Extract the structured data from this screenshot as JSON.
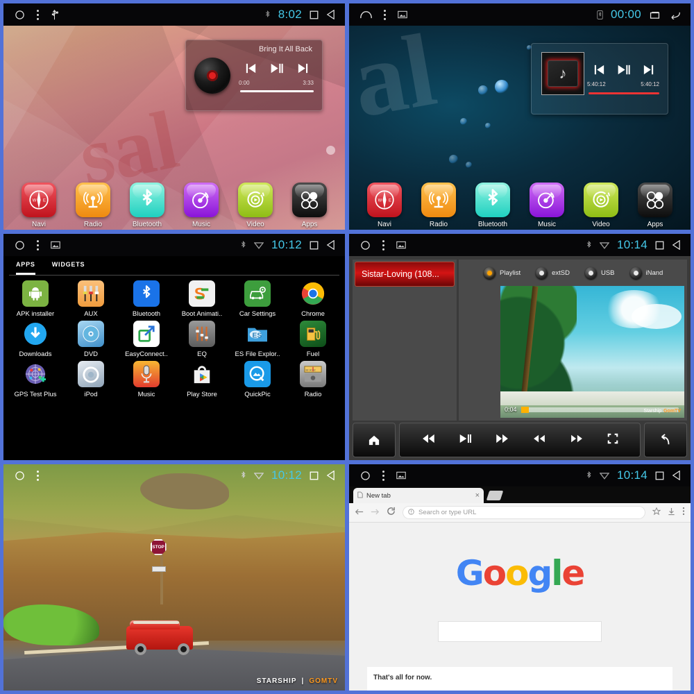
{
  "meta": {
    "frame_color": "#5272d8",
    "accent_cyan": "#45c8e8"
  },
  "panels": {
    "home_red": {
      "status": {
        "clock": "8:02",
        "left_icons": [
          "home-circle-icon",
          "menu-dots-icon",
          "usb-icon"
        ],
        "right_icons": [
          "bluetooth-icon",
          "recents-square-icon",
          "back-triangle-icon"
        ]
      },
      "widget": {
        "title": "Bring It All Back",
        "elapsed": "0:00",
        "duration": "3:33",
        "controls": [
          "previous-track",
          "play-pause",
          "next-track"
        ]
      },
      "watermark": "sal",
      "dock": [
        {
          "label": "Navi",
          "icon": "compass-icon"
        },
        {
          "label": "Radio",
          "icon": "radio-tower-icon"
        },
        {
          "label": "Bluetooth",
          "icon": "bluetooth-icon"
        },
        {
          "label": "Music",
          "icon": "music-disc-icon"
        },
        {
          "label": "Video",
          "icon": "video-play-icon"
        },
        {
          "label": "Apps",
          "icon": "apps-grid-icon"
        }
      ]
    },
    "home_blue": {
      "status": {
        "clock": "00:00",
        "left_icons": [
          "home-outline-icon",
          "menu-dots-icon",
          "screenshot-icon"
        ],
        "right_icons": [
          "bluetooth-icon",
          "recents-square-icon",
          "back-arrow-icon"
        ]
      },
      "widget": {
        "title": "",
        "elapsed": "5:40:12",
        "duration": "5:40:12",
        "controls": [
          "previous-track",
          "play-pause",
          "next-track"
        ],
        "art": "music-folder-icon"
      },
      "watermark": "al",
      "dock": [
        {
          "label": "Navi",
          "icon": "compass-icon"
        },
        {
          "label": "Radio",
          "icon": "radio-tower-icon"
        },
        {
          "label": "Bluetooth",
          "icon": "bluetooth-icon"
        },
        {
          "label": "Music",
          "icon": "music-disc-icon"
        },
        {
          "label": "Video",
          "icon": "video-play-icon"
        },
        {
          "label": "Apps",
          "icon": "apps-grid-icon"
        }
      ]
    },
    "app_drawer": {
      "status": {
        "clock": "10:12",
        "left_icons": [
          "home-circle-icon",
          "menu-dots-icon",
          "screenshot-icon"
        ],
        "right_icons": [
          "bluetooth-icon",
          "wifi-icon",
          "recents-square-icon",
          "back-triangle-icon"
        ]
      },
      "tabs": [
        {
          "label": "APPS",
          "active": true
        },
        {
          "label": "WIDGETS",
          "active": false
        }
      ],
      "apps": [
        {
          "label": "APK installer",
          "icon": "android-robot-icon"
        },
        {
          "label": "AUX",
          "icon": "rca-cables-icon"
        },
        {
          "label": "Bluetooth",
          "icon": "bluetooth-icon"
        },
        {
          "label": "Boot Animati..",
          "icon": "letter-s-icon"
        },
        {
          "label": "Car Settings",
          "icon": "car-gear-icon"
        },
        {
          "label": "Chrome",
          "icon": "chrome-icon"
        },
        {
          "label": "Downloads",
          "icon": "download-arrow-icon"
        },
        {
          "label": "DVD",
          "icon": "disc-icon"
        },
        {
          "label": "EasyConnect..",
          "icon": "external-link-icon"
        },
        {
          "label": "EQ",
          "icon": "sliders-icon"
        },
        {
          "label": "ES File Explor..",
          "icon": "es-folder-icon"
        },
        {
          "label": "Fuel",
          "icon": "fuel-pump-icon"
        },
        {
          "label": "GPS Test Plus",
          "icon": "gps-radar-icon"
        },
        {
          "label": "iPod",
          "icon": "ipod-icon"
        },
        {
          "label": "Music",
          "icon": "microphone-icon"
        },
        {
          "label": "Play Store",
          "icon": "play-store-icon"
        },
        {
          "label": "QuickPic",
          "icon": "photo-q-icon"
        },
        {
          "label": "Radio",
          "icon": "radio-dial-icon"
        }
      ]
    },
    "video_player": {
      "status": {
        "clock": "10:14",
        "left_icons": [
          "home-circle-icon",
          "menu-dots-icon",
          "screenshot-icon"
        ],
        "right_icons": [
          "bluetooth-icon",
          "wifi-icon",
          "recents-square-icon",
          "back-triangle-icon"
        ]
      },
      "playlist": [
        {
          "label": "Sistar-Loving (108...",
          "selected": true
        }
      ],
      "sources": [
        {
          "label": "Playlist",
          "active": true
        },
        {
          "label": "extSD",
          "active": false
        },
        {
          "label": "USB",
          "active": false
        },
        {
          "label": "iNand",
          "active": false
        }
      ],
      "video": {
        "elapsed": "0:04",
        "watermark_left": "Starship",
        "watermark_right": "GomTV"
      },
      "controls": [
        {
          "name": "home-button",
          "glyph": "home"
        },
        {
          "name": "previous-button",
          "glyph": "prev"
        },
        {
          "name": "play-pause-button",
          "glyph": "playpause"
        },
        {
          "name": "next-button",
          "glyph": "next"
        },
        {
          "name": "rewind-button",
          "glyph": "rew"
        },
        {
          "name": "fast-forward-button",
          "glyph": "ff"
        },
        {
          "name": "fullscreen-button",
          "glyph": "fs"
        },
        {
          "name": "back-button",
          "glyph": "back"
        }
      ]
    },
    "fullscreen_video": {
      "status": {
        "clock": "10:12",
        "left_icons": [
          "home-circle-icon",
          "menu-dots-icon"
        ],
        "right_icons": [
          "bluetooth-icon",
          "wifi-icon",
          "recents-square-icon",
          "back-triangle-icon"
        ]
      },
      "overlay": {
        "brand_left": "STARSHIP",
        "brand_sep": "|",
        "brand_right": "GOMTV",
        "sign_text": "STOP"
      }
    },
    "chrome": {
      "status": {
        "clock": "10:14",
        "left_icons": [
          "home-circle-icon",
          "menu-dots-icon",
          "screenshot-icon"
        ],
        "right_icons": [
          "bluetooth-icon",
          "wifi-icon",
          "recents-square-icon",
          "back-triangle-icon"
        ]
      },
      "tab": {
        "title": "New tab"
      },
      "toolbar": {
        "omnibox_placeholder": "Search or type URL",
        "icons": [
          "back-arrow-icon",
          "forward-arrow-icon",
          "reload-icon",
          "info-icon",
          "star-icon",
          "download-icon",
          "overflow-menu-icon"
        ]
      },
      "page": {
        "logo": "Google",
        "logo_letters": [
          "G",
          "o",
          "o",
          "g",
          "l",
          "e"
        ],
        "card_text": "That's all for now."
      }
    }
  }
}
